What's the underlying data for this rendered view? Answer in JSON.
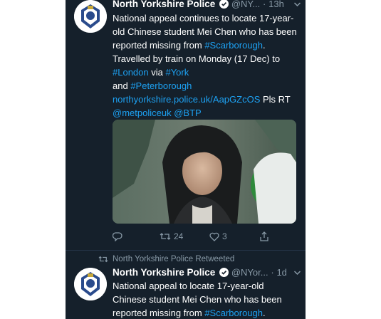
{
  "tweets": [
    {
      "name": "North Yorkshire Police",
      "handle": "@NY...",
      "separator": "·",
      "time": "13h",
      "text_1": "National appeal continues to locate 17-year-old Chinese student Mei Chen who has been reported missing from ",
      "hashtag_scarborough": "#Scarborough",
      "text_2": ". Travelled by train on Monday (17 Dec) to ",
      "hashtag_london": "#London",
      "text_3": " via ",
      "hashtag_york": "#York",
      "text_4": " and ",
      "hashtag_peterborough": "#Peterborough",
      "url": "northyorkshire.police.uk/AapGZcOS",
      "text_5": " Pls RT ",
      "mention_metpolice": "@metpoliceuk",
      "mention_btp": "@BTP",
      "retweet_count": "24",
      "like_count": "3"
    },
    {
      "retweet_context": "North Yorkshire Police Retweeted",
      "name": "North Yorkshire Police",
      "handle": "@NYor...",
      "separator": "·",
      "time": "1d",
      "text_1": "National appeal to locate 17-year-old Chinese student Mei Chen who has been reported missing from ",
      "hashtag_scarborough": "#Scarborough",
      "text_2": "."
    }
  ],
  "icons": {
    "avatar": "police-crest-icon",
    "verified": "verified-badge-icon",
    "caret": "chevron-down-icon",
    "reply": "reply-icon",
    "retweet": "retweet-icon",
    "like": "heart-icon",
    "share": "share-icon"
  },
  "colors": {
    "background": "#15202b",
    "link": "#1da1f2",
    "secondary_text": "#8899a6",
    "primary_text": "#ffffff",
    "divider": "#243447"
  }
}
